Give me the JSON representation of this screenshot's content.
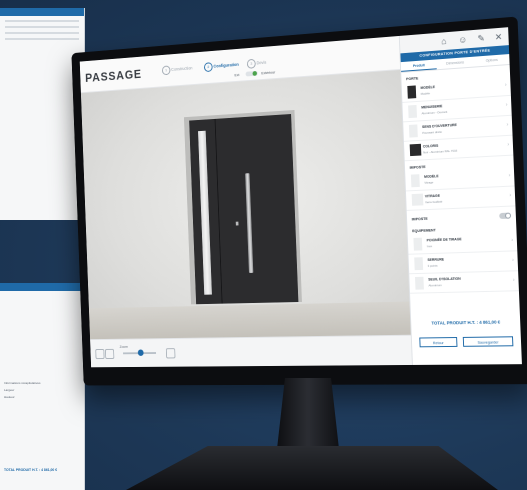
{
  "app": {
    "logo_text": "PASSAGE"
  },
  "breadcrumb": {
    "steps": [
      {
        "num": "1",
        "label": "Construction",
        "active": false
      },
      {
        "num": "2",
        "label": "Configuration",
        "active": true
      },
      {
        "num": "3",
        "label": "Devis"
      }
    ],
    "view_left": "Ext",
    "view_right": "Extérieur"
  },
  "panel": {
    "title": "CONFIGURATION PORTE D'ENTRÉE",
    "tabs": [
      "Produit",
      "Dimensions",
      "Options"
    ],
    "sections": [
      {
        "title": "PORTE",
        "options": [
          {
            "name": "MODÈLE",
            "sub": "Modèle",
            "thumb": "door"
          },
          {
            "name": "MENUISERIE",
            "sub": "Aluminium - Ouvrant",
            "thumb": "light"
          },
          {
            "name": "SENS D'OUVERTURE",
            "sub": "Poussant droite",
            "thumb": "light"
          },
          {
            "name": "COLORIS",
            "sub": "Noir - Aluminium RAL 7016",
            "thumb": "dark"
          }
        ]
      },
      {
        "title": "IMPOSTE",
        "options": [
          {
            "name": "MODÈLE",
            "sub": "Vitrage",
            "thumb": "light"
          },
          {
            "name": "VITRAGE",
            "sub": "Verre feuilleté",
            "thumb": "light"
          }
        ]
      },
      {
        "title": "EQUIPEMENT",
        "options": [
          {
            "name": "POIGNÉE DE TIRAGE",
            "sub": "Inox",
            "thumb": "light"
          },
          {
            "name": "SERRURE",
            "sub": "3 points",
            "thumb": "light"
          },
          {
            "name": "SEUIL D'ISOLATION",
            "sub": "Aluminium",
            "thumb": "light"
          }
        ]
      }
    ],
    "toggle_label": "IMPOSTE",
    "total": "TOTAL PRODUIT H.T. : 4 861,00 €",
    "prev_button": "Retour",
    "next_button": "Sauvegarder"
  },
  "bottom": {
    "zoom_label": "Zoom"
  },
  "bg_screen_bottom": {
    "lines": [
      "Informations récapitulatives",
      "Largeur",
      "Hauteur"
    ],
    "total": "TOTAL PRODUIT H.T. : 4 861,00 €"
  },
  "colors": {
    "accent": "#1f6aa8",
    "door": "#2c2c2e",
    "background": "#1f3a5c"
  }
}
